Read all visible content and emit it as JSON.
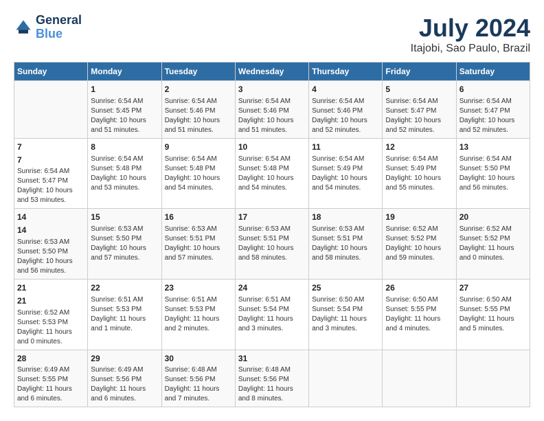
{
  "header": {
    "logo_line1": "General",
    "logo_line2": "Blue",
    "title": "July 2024",
    "subtitle": "Itajobi, Sao Paulo, Brazil"
  },
  "days_of_week": [
    "Sunday",
    "Monday",
    "Tuesday",
    "Wednesday",
    "Thursday",
    "Friday",
    "Saturday"
  ],
  "weeks": [
    [
      {
        "day": "",
        "content": ""
      },
      {
        "day": "1",
        "content": "Sunrise: 6:54 AM\nSunset: 5:45 PM\nDaylight: 10 hours\nand 51 minutes."
      },
      {
        "day": "2",
        "content": "Sunrise: 6:54 AM\nSunset: 5:46 PM\nDaylight: 10 hours\nand 51 minutes."
      },
      {
        "day": "3",
        "content": "Sunrise: 6:54 AM\nSunset: 5:46 PM\nDaylight: 10 hours\nand 51 minutes."
      },
      {
        "day": "4",
        "content": "Sunrise: 6:54 AM\nSunset: 5:46 PM\nDaylight: 10 hours\nand 52 minutes."
      },
      {
        "day": "5",
        "content": "Sunrise: 6:54 AM\nSunset: 5:47 PM\nDaylight: 10 hours\nand 52 minutes."
      },
      {
        "day": "6",
        "content": "Sunrise: 6:54 AM\nSunset: 5:47 PM\nDaylight: 10 hours\nand 52 minutes."
      }
    ],
    [
      {
        "day": "7",
        "content": ""
      },
      {
        "day": "8",
        "content": "Sunrise: 6:54 AM\nSunset: 5:48 PM\nDaylight: 10 hours\nand 53 minutes."
      },
      {
        "day": "9",
        "content": "Sunrise: 6:54 AM\nSunset: 5:48 PM\nDaylight: 10 hours\nand 54 minutes."
      },
      {
        "day": "10",
        "content": "Sunrise: 6:54 AM\nSunset: 5:48 PM\nDaylight: 10 hours\nand 54 minutes."
      },
      {
        "day": "11",
        "content": "Sunrise: 6:54 AM\nSunset: 5:49 PM\nDaylight: 10 hours\nand 54 minutes."
      },
      {
        "day": "12",
        "content": "Sunrise: 6:54 AM\nSunset: 5:49 PM\nDaylight: 10 hours\nand 55 minutes."
      },
      {
        "day": "13",
        "content": "Sunrise: 6:54 AM\nSunset: 5:50 PM\nDaylight: 10 hours\nand 56 minutes."
      }
    ],
    [
      {
        "day": "14",
        "content": ""
      },
      {
        "day": "15",
        "content": "Sunrise: 6:53 AM\nSunset: 5:50 PM\nDaylight: 10 hours\nand 57 minutes."
      },
      {
        "day": "16",
        "content": "Sunrise: 6:53 AM\nSunset: 5:51 PM\nDaylight: 10 hours\nand 57 minutes."
      },
      {
        "day": "17",
        "content": "Sunrise: 6:53 AM\nSunset: 5:51 PM\nDaylight: 10 hours\nand 58 minutes."
      },
      {
        "day": "18",
        "content": "Sunrise: 6:53 AM\nSunset: 5:51 PM\nDaylight: 10 hours\nand 58 minutes."
      },
      {
        "day": "19",
        "content": "Sunrise: 6:52 AM\nSunset: 5:52 PM\nDaylight: 10 hours\nand 59 minutes."
      },
      {
        "day": "20",
        "content": "Sunrise: 6:52 AM\nSunset: 5:52 PM\nDaylight: 11 hours\nand 0 minutes."
      }
    ],
    [
      {
        "day": "21",
        "content": ""
      },
      {
        "day": "22",
        "content": "Sunrise: 6:51 AM\nSunset: 5:53 PM\nDaylight: 11 hours\nand 1 minute."
      },
      {
        "day": "23",
        "content": "Sunrise: 6:51 AM\nSunset: 5:53 PM\nDaylight: 11 hours\nand 2 minutes."
      },
      {
        "day": "24",
        "content": "Sunrise: 6:51 AM\nSunset: 5:54 PM\nDaylight: 11 hours\nand 3 minutes."
      },
      {
        "day": "25",
        "content": "Sunrise: 6:50 AM\nSunset: 5:54 PM\nDaylight: 11 hours\nand 3 minutes."
      },
      {
        "day": "26",
        "content": "Sunrise: 6:50 AM\nSunset: 5:55 PM\nDaylight: 11 hours\nand 4 minutes."
      },
      {
        "day": "27",
        "content": "Sunrise: 6:50 AM\nSunset: 5:55 PM\nDaylight: 11 hours\nand 5 minutes."
      }
    ],
    [
      {
        "day": "28",
        "content": "Sunrise: 6:49 AM\nSunset: 5:55 PM\nDaylight: 11 hours\nand 6 minutes."
      },
      {
        "day": "29",
        "content": "Sunrise: 6:49 AM\nSunset: 5:56 PM\nDaylight: 11 hours\nand 6 minutes."
      },
      {
        "day": "30",
        "content": "Sunrise: 6:48 AM\nSunset: 5:56 PM\nDaylight: 11 hours\nand 7 minutes."
      },
      {
        "day": "31",
        "content": "Sunrise: 6:48 AM\nSunset: 5:56 PM\nDaylight: 11 hours\nand 8 minutes."
      },
      {
        "day": "",
        "content": ""
      },
      {
        "day": "",
        "content": ""
      },
      {
        "day": "",
        "content": ""
      }
    ]
  ],
  "week1_row1": {
    "sun": {
      "day": "",
      "content": ""
    },
    "mon": {
      "day": "1",
      "sunrise": "Sunrise: 6:54 AM",
      "sunset": "Sunset: 5:45 PM",
      "daylight": "Daylight: 10 hours and 51 minutes."
    }
  }
}
